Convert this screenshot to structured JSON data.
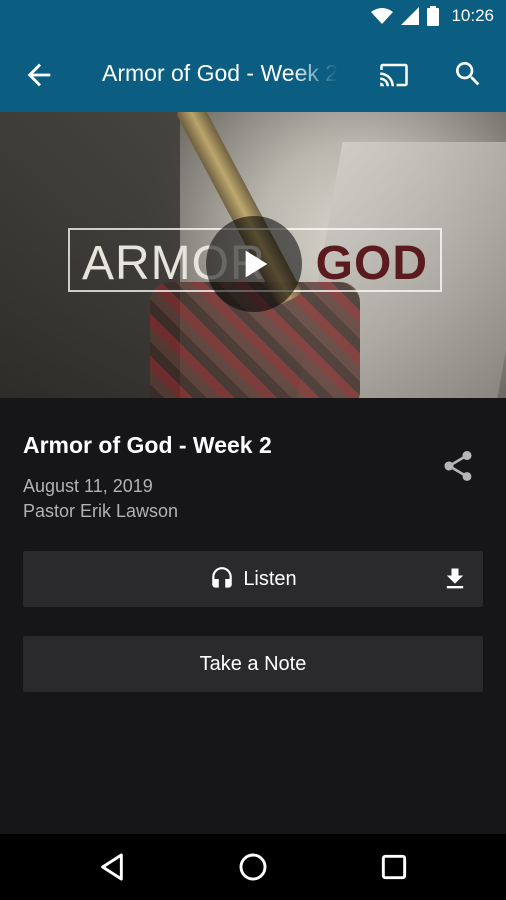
{
  "status_bar": {
    "time": "10:26",
    "icons": [
      "wifi-icon",
      "signal-icon",
      "battery-icon"
    ]
  },
  "app_bar": {
    "title": "Armor of God - Week 2",
    "icons": [
      "back-arrow-icon",
      "cast-icon",
      "search-icon"
    ]
  },
  "hero": {
    "logo_left": "ARMOR",
    "logo_right": "GOD",
    "play_icon": "play-icon"
  },
  "sermon": {
    "title": "Armor of God - Week 2",
    "date": "August 11, 2019",
    "speaker": "Pastor Erik Lawson",
    "share_icon": "share-icon"
  },
  "actions": {
    "listen_label": "Listen",
    "listen_icon": "headphones-icon",
    "download_icon": "download-icon",
    "note_label": "Take a Note"
  },
  "nav_bar": {
    "icons": [
      "back-triangle-icon",
      "home-circle-icon",
      "recents-square-icon"
    ]
  },
  "colors": {
    "primary": "#0b5e82",
    "background": "#161618",
    "button_bg": "#2a2a2c",
    "secondary_text": "#b2b2b2"
  }
}
